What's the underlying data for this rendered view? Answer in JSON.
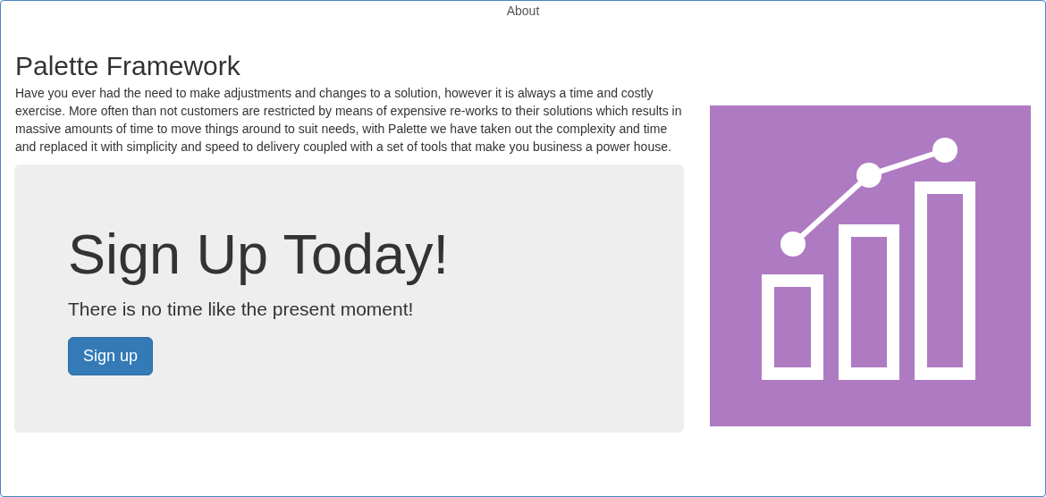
{
  "nav": {
    "links": [
      {
        "label": "About"
      }
    ]
  },
  "title": "Palette Framework",
  "intro": "Have you ever had the need to make adjustments and changes to a solution, however it is always a time and costly exercise. More often than not customers are restricted by means of expensive re-works to their solutions which results in massive amounts of time to move things around to suit needs, with Palette we have taken out the complexity and time and replaced it with simplicity and speed to delivery coupled with a set of tools that make you business a power house.",
  "jumbotron": {
    "heading": "Sign Up Today!",
    "lead": "There is no time like the present moment!",
    "button": "Sign up"
  }
}
